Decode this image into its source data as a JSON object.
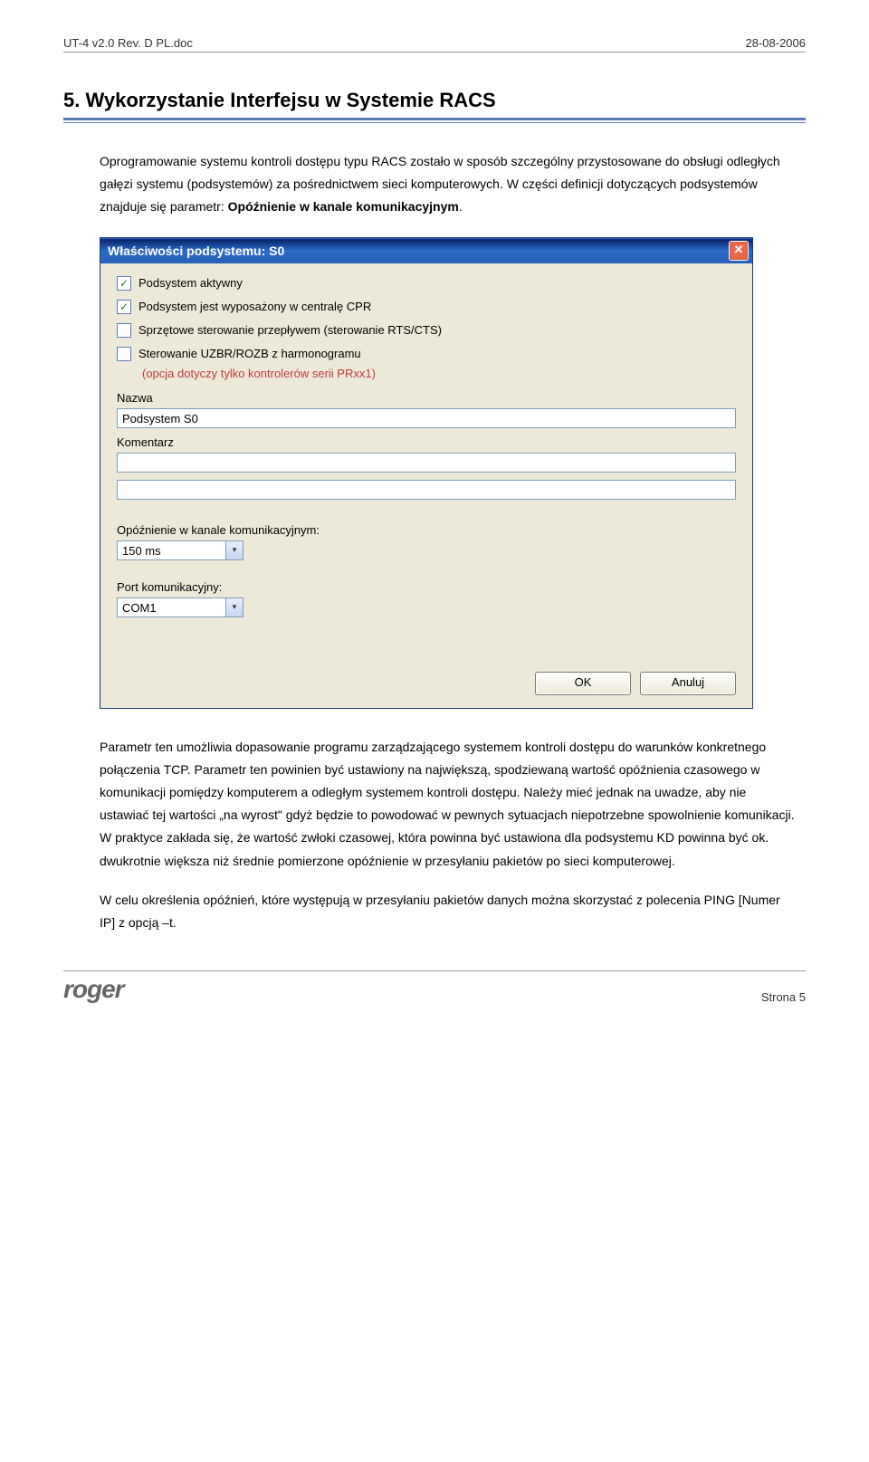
{
  "header": {
    "left": "UT-4 v2.0 Rev. D PL.doc",
    "right": "28-08-2006"
  },
  "section": {
    "number": "5.",
    "title": "Wykorzystanie Interfejsu w Systemie RACS"
  },
  "para1": "Oprogramowanie systemu kontroli dostępu typu RACS zostało w sposób szczególny przystosowane do obsługi odległych gałęzi systemu (podsystemów) za pośrednictwem sieci komputerowych. W części definicji dotyczących podsystemów znajduje się parametr: ",
  "para1_bold": "Opóźnienie w kanale komunikacyjnym",
  "para1_end": ".",
  "dialog": {
    "title": "Właściwości podsystemu: S0",
    "close": "✕",
    "checks": [
      {
        "label": "Podsystem aktywny",
        "checked": true
      },
      {
        "label": "Podsystem jest wyposażony w centralę CPR",
        "checked": true
      },
      {
        "label": "Sprzętowe sterowanie przepływem (sterowanie RTS/CTS)",
        "checked": false
      },
      {
        "label": "Sterowanie UZBR/ROZB z harmonogramu",
        "checked": false
      }
    ],
    "note": "(opcja dotyczy tylko kontrolerów serii PRxx1)",
    "name_label": "Nazwa",
    "name_value": "Podsystem S0",
    "comment_label": "Komentarz",
    "comment_value1": "",
    "comment_value2": "",
    "delay_label": "Opóźnienie w kanale komunikacyjnym:",
    "delay_value": "150 ms",
    "port_label": "Port komunikacyjny:",
    "port_value": "COM1",
    "ok": "OK",
    "cancel": "Anuluj"
  },
  "para2": "Parametr ten umożliwia dopasowanie programu zarządzającego systemem kontroli dostępu do warunków konkretnego połączenia TCP. Parametr ten powinien być ustawiony na największą, spodziewaną wartość opóźnienia czasowego w komunikacji pomiędzy komputerem a odległym systemem kontroli dostępu. Należy mieć jednak na uwadze, aby nie ustawiać tej wartości  „na wyrost\" gdyż będzie to powodować w pewnych sytuacjach niepotrzebne spowolnienie komunikacji. W praktyce zakłada się, że wartość zwłoki czasowej, która powinna być ustawiona dla podsystemu KD powinna być ok. dwukrotnie większa niż średnie pomierzone opóźnienie w przesyłaniu pakietów po sieci komputerowej.",
  "para3": "W celu określenia opóźnień, które występują w przesyłaniu pakietów danych można skorzystać z polecenia PING [Numer IP] z opcją –t.",
  "footer": {
    "logo": "roger",
    "page": "Strona 5"
  }
}
